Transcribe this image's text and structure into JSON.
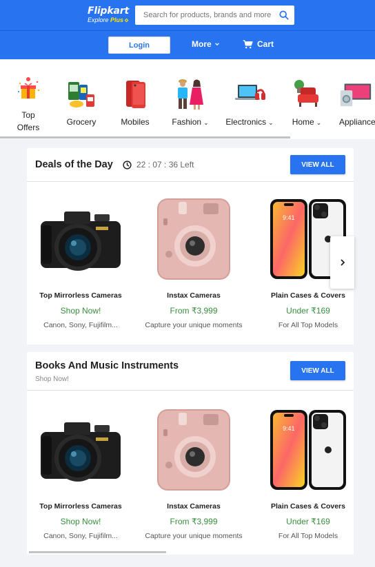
{
  "header": {
    "logo_text": "Flipkart",
    "logo_sub_explore": "Explore",
    "logo_sub_plus": "Plus",
    "search_placeholder": "Search for products, brands and more",
    "login_label": "Login",
    "more_label": "More",
    "cart_label": "Cart",
    "icons": [
      "search-icon",
      "chevron-down-icon",
      "cart-icon"
    ],
    "brand_color": "#2874f0"
  },
  "categories": [
    {
      "label_line1": "Top",
      "label_line2": "Offers",
      "has_dropdown": false,
      "icon": "top-offers-icon"
    },
    {
      "label": "Grocery",
      "has_dropdown": false,
      "icon": "grocery-icon"
    },
    {
      "label": "Mobiles",
      "has_dropdown": false,
      "icon": "mobiles-icon"
    },
    {
      "label": "Fashion",
      "has_dropdown": true,
      "icon": "fashion-icon"
    },
    {
      "label": "Electronics",
      "has_dropdown": true,
      "icon": "electronics-icon"
    },
    {
      "label": "Home",
      "has_dropdown": true,
      "icon": "home-icon"
    },
    {
      "label": "Appliances",
      "has_dropdown": false,
      "icon": "appliances-icon"
    }
  ],
  "deals": {
    "title": "Deals of the Day",
    "timer": "22 : 07 : 36 Left",
    "view_all": "VIEW ALL",
    "products": [
      {
        "name": "Top Mirrorless Cameras",
        "price": "Shop Now!",
        "desc": "Canon, Sony, Fujifilm..."
      },
      {
        "name": "Instax Cameras",
        "price": "From ₹3,999",
        "desc": "Capture your unique moments"
      },
      {
        "name": "Plain Cases & Covers",
        "price": "Under ₹169",
        "desc": "For All Top Models"
      }
    ]
  },
  "books": {
    "title": "Books And Music Instruments",
    "subtitle": "Shop Now!",
    "view_all": "VIEW ALL",
    "products": [
      {
        "name": "Top Mirrorless Cameras",
        "price": "Shop Now!",
        "desc": "Canon, Sony, Fujifilm..."
      },
      {
        "name": "Instax Cameras",
        "price": "From ₹3,999",
        "desc": "Capture your unique moments"
      },
      {
        "name": "Plain Cases & Covers",
        "price": "Under ₹169",
        "desc": "For All Top Models"
      }
    ]
  },
  "colors": {
    "accent": "#2874f0",
    "price_green": "#388e3c",
    "background": "#f1f3f6"
  }
}
